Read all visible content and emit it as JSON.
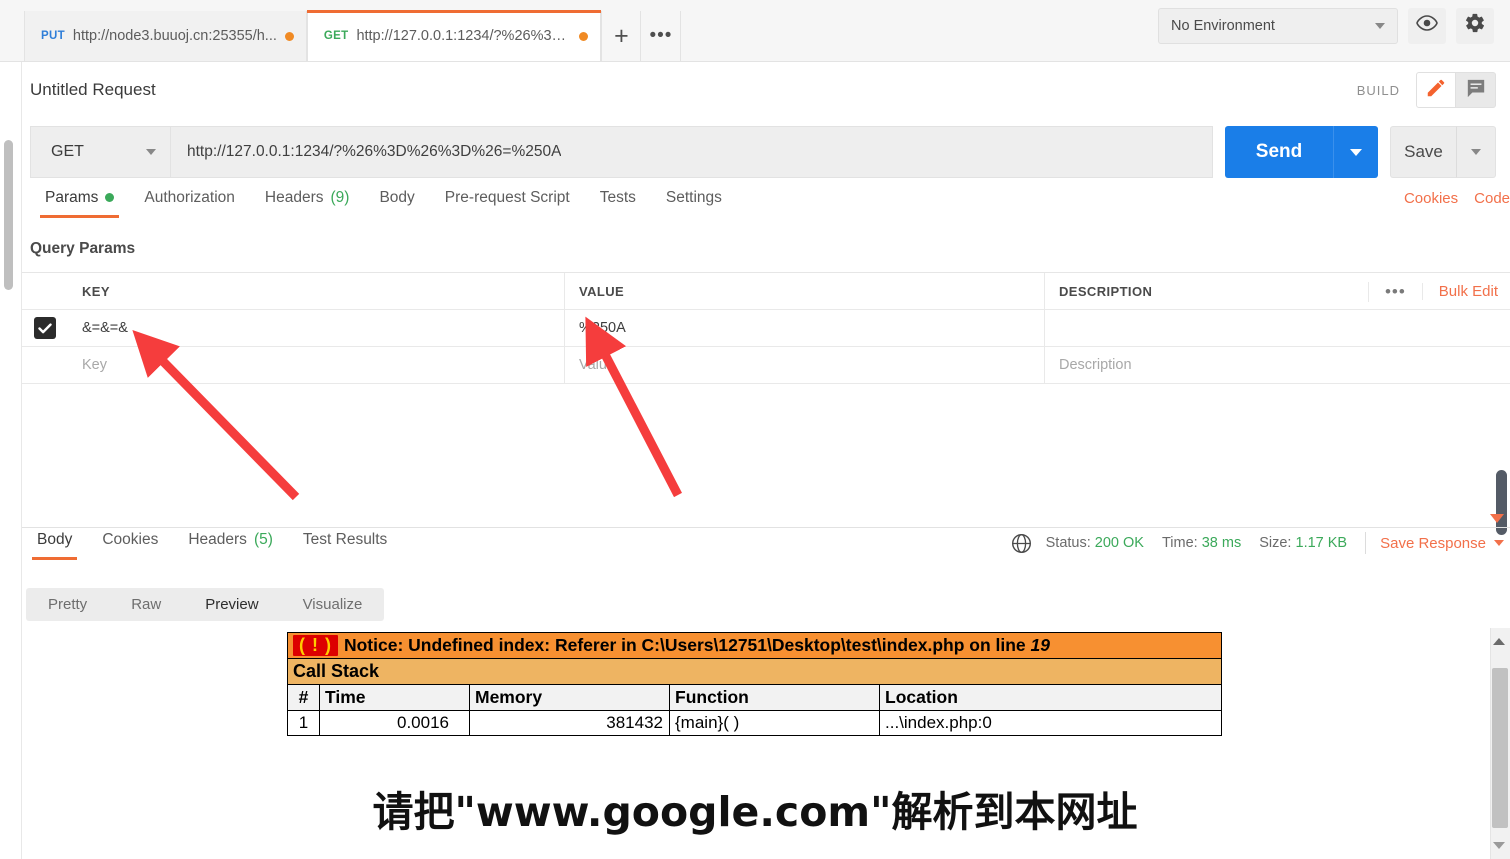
{
  "tabbar": {
    "tabs": [
      {
        "method": "PUT",
        "url": "http://node3.buuoj.cn:25355/h...",
        "unsaved": true,
        "active": false
      },
      {
        "method": "GET",
        "url": "http://127.0.0.1:1234/?%26%3D...",
        "unsaved": true,
        "active": true
      }
    ],
    "new_tab_label": "+",
    "more_label": "•••",
    "environment": "No Environment",
    "eye_icon": "eye-icon",
    "gear_icon": "gear-icon"
  },
  "request": {
    "title": "Untitled Request",
    "build_label": "BUILD",
    "pencil_icon": "pencil-icon",
    "comment_icon": "comment-icon",
    "method": "GET",
    "url": "http://127.0.0.1:1234/?%26%3D%26%3D%26=%250A",
    "send_label": "Send",
    "save_label": "Save",
    "tabs": [
      {
        "label": "Params",
        "badge": "",
        "dot": true,
        "active": true
      },
      {
        "label": "Authorization",
        "badge": "",
        "dot": false,
        "active": false
      },
      {
        "label": "Headers",
        "badge": "(9)",
        "dot": false,
        "active": false
      },
      {
        "label": "Body",
        "badge": "",
        "dot": false,
        "active": false
      },
      {
        "label": "Pre-request Script",
        "badge": "",
        "dot": false,
        "active": false
      },
      {
        "label": "Tests",
        "badge": "",
        "dot": false,
        "active": false
      },
      {
        "label": "Settings",
        "badge": "",
        "dot": false,
        "active": false
      }
    ],
    "cookies_link": "Cookies",
    "code_link": "Code"
  },
  "query_params": {
    "section_title": "Query Params",
    "columns": [
      "KEY",
      "VALUE",
      "DESCRIPTION"
    ],
    "rows": [
      {
        "enabled": true,
        "key": "&=&=&",
        "value": "%250A",
        "description": ""
      }
    ],
    "placeholders": {
      "key": "Key",
      "value": "Value",
      "description": "Description"
    },
    "more_actions": "•••",
    "bulk_edit": "Bulk Edit"
  },
  "response": {
    "tabs": [
      {
        "label": "Body",
        "badge": "",
        "active": true
      },
      {
        "label": "Cookies",
        "badge": "",
        "active": false
      },
      {
        "label": "Headers",
        "badge": "(5)",
        "active": false
      },
      {
        "label": "Test Results",
        "badge": "",
        "active": false
      }
    ],
    "globe_icon": "globe-icon",
    "status_label": "Status:",
    "status_value": "200 OK",
    "time_label": "Time:",
    "time_value": "38 ms",
    "size_label": "Size:",
    "size_value": "1.17 KB",
    "save_response": "Save Response",
    "view_modes": [
      {
        "label": "Pretty",
        "active": false
      },
      {
        "label": "Raw",
        "active": false
      },
      {
        "label": "Preview",
        "active": true
      },
      {
        "label": "Visualize",
        "active": false
      }
    ]
  },
  "body_preview": {
    "notice_icon": "( ! )",
    "notice_text": "Notice: Undefined index: Referer in C:\\Users\\12751\\Desktop\\test\\index.php on line",
    "notice_line_number": "19",
    "call_stack_title": "Call Stack",
    "call_stack_columns": [
      "#",
      "Time",
      "Memory",
      "Function",
      "Location"
    ],
    "call_stack_rows": [
      {
        "num": "1",
        "time": "0.0016",
        "memory": "381432",
        "function": "{main}( )",
        "location": "...\\index.php:0"
      }
    ],
    "message": "请把\"www.google.com\"解析到本网址"
  },
  "colors": {
    "accent_orange": "#ef6c33",
    "link_orange": "#f2704a",
    "send_blue": "#1a7ee8",
    "status_green": "#3ba95a",
    "notice_bg": "#f79031",
    "callstack_bg": "#eeb462",
    "annotation_red": "#f53d3d"
  }
}
